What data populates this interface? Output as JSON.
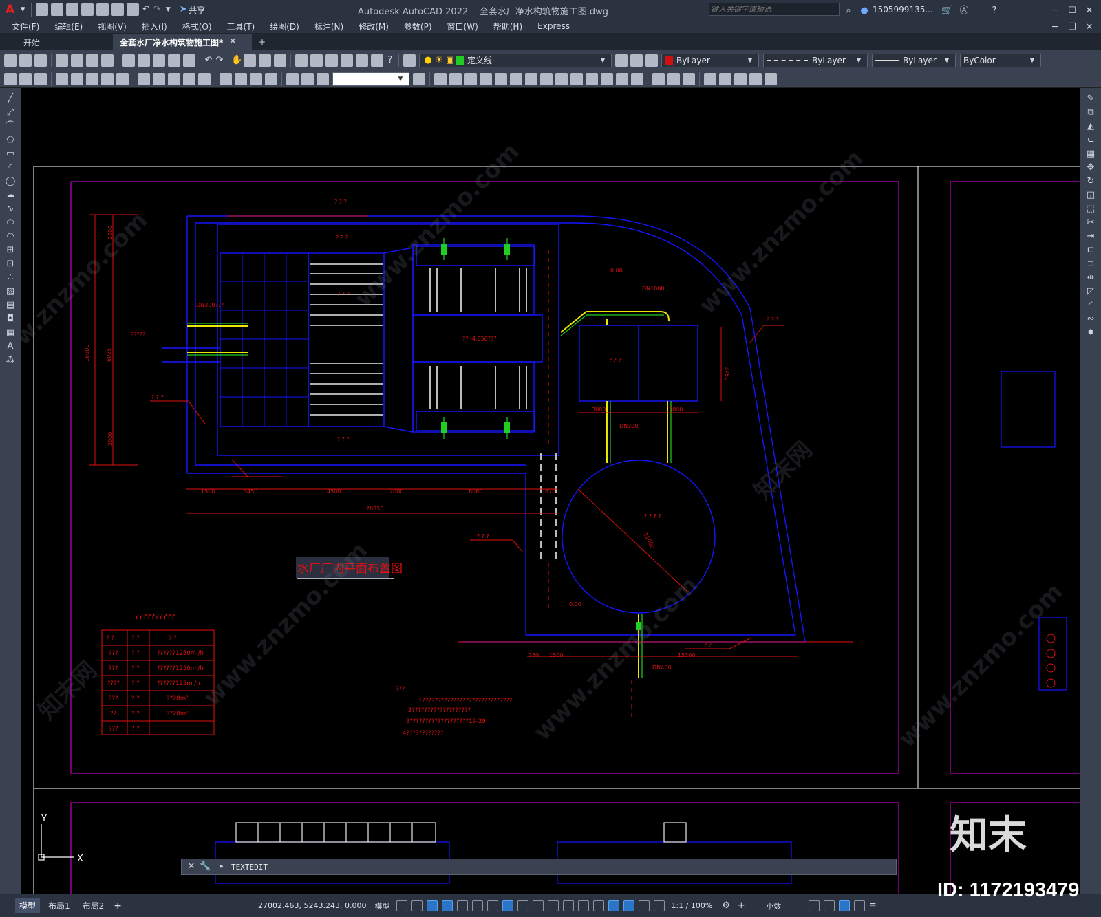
{
  "app": {
    "title": "Autodesk AutoCAD 2022",
    "filename": "全套水厂净水构筑物施工图.dwg",
    "share_label": "共享",
    "search_placeholder": "键入关键字或短语",
    "user": "1505999135...",
    "logo_letter": "A"
  },
  "menu": [
    "文件(F)",
    "编辑(E)",
    "视图(V)",
    "插入(I)",
    "格式(O)",
    "工具(T)",
    "绘图(D)",
    "标注(N)",
    "修改(M)",
    "参数(P)",
    "窗口(W)",
    "帮助(H)",
    "Express"
  ],
  "tabs": {
    "start": "开始",
    "active": "全套水厂净水构筑物施工图*",
    "add": "+"
  },
  "properties": {
    "layer": "定义线",
    "color": "ByLayer",
    "linetype": "ByLayer",
    "lineweight": "ByLayer",
    "plotstyle": "ByColor",
    "colors": {
      "red": "#d01010",
      "layer_swatch": "#22cc22"
    }
  },
  "command": {
    "text": "TEXTEDIT"
  },
  "layout_tabs": [
    "模型",
    "布局1",
    "布局2"
  ],
  "status": {
    "coords": "27002.463, 5243.243, 0.000",
    "space": "模型",
    "scale": "1:1 / 100%",
    "units": "小数"
  },
  "watermark": {
    "site": "www.znzmo.com",
    "brand": "知末网",
    "brand_logo": "知末",
    "id_label": "ID: 1172193479"
  },
  "drawing": {
    "title": "水厂厂内平面布置图",
    "heading": "??????????",
    "table_rows": [
      [
        "? ?",
        "? ?",
        "?    ?"
      ],
      [
        "???",
        "? ?",
        "??????1250m /h"
      ],
      [
        "???",
        "? ?",
        "??????1250m /h"
      ],
      [
        "????",
        "? ?",
        "??????125m /h"
      ],
      [
        "???",
        "? ?",
        "??28m²"
      ],
      [
        "??",
        "? ?",
        "??28m²"
      ],
      [
        "???",
        "? ?",
        ""
      ]
    ],
    "notes": [
      "???",
      "1?????????????????????????????",
      "2???????????????????",
      "3???????????????????19-29",
      "4????????????"
    ],
    "dims_bottom": [
      "1500",
      "3450",
      "4500",
      "2000",
      "6060",
      "870"
    ],
    "dim_total": "20350",
    "dims_right": [
      "750",
      "1500",
      "15300"
    ],
    "dims_left": [
      "2000",
      "16900",
      "6025",
      "2000"
    ],
    "pipe_labels": [
      "DN300???",
      "DN1000",
      "DN300",
      "DN400",
      "?????"
    ],
    "elev_labels": [
      "0.00",
      "0.00",
      "?? -4.650???"
    ],
    "circle_dim": "11000",
    "tank_dims": [
      "3750",
      "3000",
      "3000"
    ],
    "structure_labels": [
      "? ? ?",
      "? ? ?",
      "? ? ?",
      "? ? ?",
      "? ? ?",
      "? ? ? ?",
      "? ? ?",
      "? ? ?",
      "? ? ?",
      "? ?"
    ]
  }
}
